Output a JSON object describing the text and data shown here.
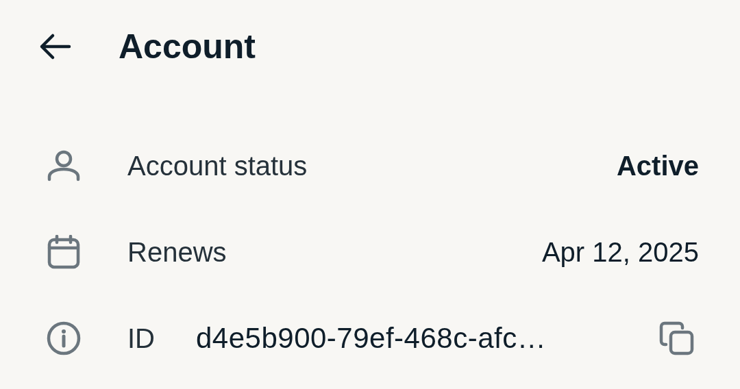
{
  "header": {
    "title": "Account"
  },
  "rows": [
    {
      "kind": "value",
      "label": "Account status",
      "value": "Active",
      "emphasis": true
    },
    {
      "kind": "value",
      "label": "Renews",
      "value": "Apr 12, 2025",
      "emphasis": false
    },
    {
      "kind": "copyable",
      "label": "ID",
      "value": "d4e5b900-79ef-468c-afc…",
      "emphasis": false
    }
  ]
}
